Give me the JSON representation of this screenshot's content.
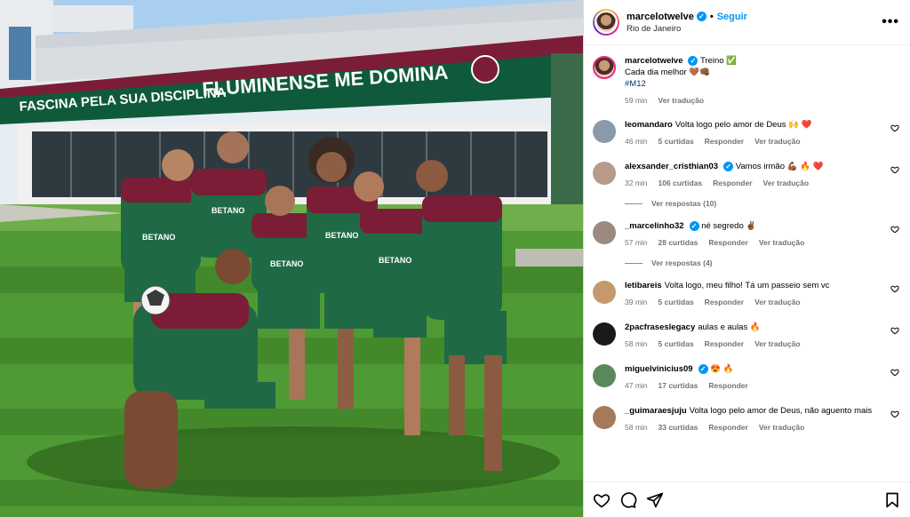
{
  "header": {
    "username": "marcelotwelve",
    "verified_mark": "✓",
    "separator": "•",
    "follow_label": "Seguir",
    "location": "Rio de Janeiro",
    "more_label": "•••"
  },
  "caption": {
    "username": "marcelotwelve",
    "text_line1": "Treino ✅",
    "text_line2": "Cada dia melhor 🤎👊🏾",
    "hashtag": "#M12",
    "time": "59 min",
    "translate": "Ver tradução"
  },
  "comments": [
    {
      "username": "leomandaro",
      "verified": false,
      "text": "Volta logo pelo amor de Deus 🙌 ❤️",
      "time": "46 min",
      "likes": "5 curtidas",
      "reply": "Responder",
      "translate": "Ver tradução",
      "avatar_color": "#8a9aa8",
      "replies": ""
    },
    {
      "username": "alexsander_cristhian03",
      "verified": true,
      "text": "Vamos irmão 💪🏾 🔥 ❤️",
      "time": "32 min",
      "likes": "106 curtidas",
      "reply": "Responder",
      "translate": "Ver tradução",
      "avatar_color": "#b89a88",
      "replies": "Ver respostas (10)"
    },
    {
      "username": "_marcelinho32",
      "verified": true,
      "text": "né segredo ✌🏾",
      "time": "57 min",
      "likes": "28 curtidas",
      "reply": "Responder",
      "translate": "Ver tradução",
      "avatar_color": "#9a8a80",
      "replies": "Ver respostas (4)"
    },
    {
      "username": "letibareis",
      "verified": false,
      "text": "Volta logo, meu filho! Tá um passeio sem vc",
      "time": "39 min",
      "likes": "5 curtidas",
      "reply": "Responder",
      "translate": "Ver tradução",
      "avatar_color": "#c49a6c",
      "replies": ""
    },
    {
      "username": "2pacfraseslegacy",
      "verified": false,
      "text": "aulas e aulas 🔥",
      "time": "58 min",
      "likes": "5 curtidas",
      "reply": "Responder",
      "translate": "Ver tradução",
      "avatar_color": "#1a1a1a",
      "replies": ""
    },
    {
      "username": "miguelvinicius09",
      "verified": true,
      "text": "😍 🔥",
      "time": "47 min",
      "likes": "17 curtidas",
      "reply": "Responder",
      "translate": "",
      "avatar_color": "#5a8a5a",
      "replies": ""
    },
    {
      "username": "_guimaraesjuju",
      "verified": false,
      "text": "Volta logo pelo amor de Deus, não aguento mais",
      "time": "58 min",
      "likes": "33 curtidas",
      "reply": "Responder",
      "translate": "Ver tradução",
      "avatar_color": "#a47a5a",
      "replies": ""
    }
  ],
  "photo": {
    "banner_left": "FASCINA PELA SUA DISCIPLINA",
    "banner_right": "FLUMINENSE ME DOMINA",
    "shirt_text": "BETANO"
  },
  "actions": {
    "like": "heart-icon",
    "comment": "comment-icon",
    "share": "share-icon",
    "save": "bookmark-icon"
  }
}
